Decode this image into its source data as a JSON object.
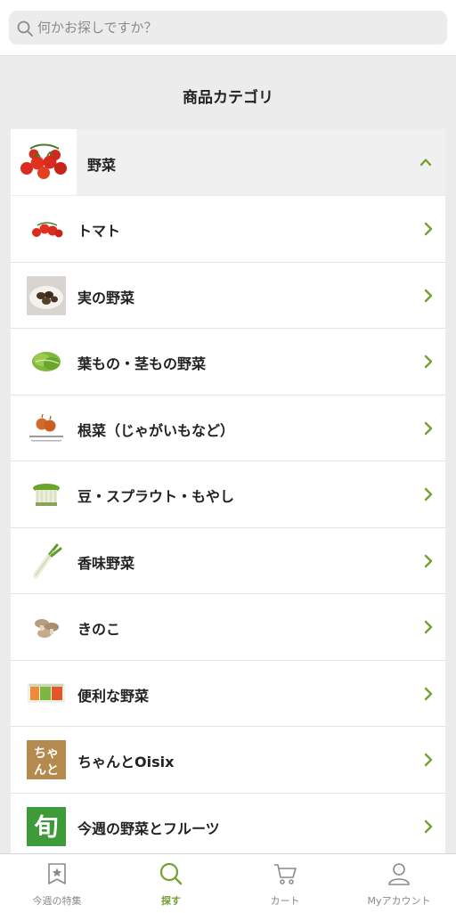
{
  "search": {
    "placeholder": "何かお探しですか？"
  },
  "page": {
    "title": "商品カテゴリ"
  },
  "category": {
    "label": "野菜",
    "expanded": true
  },
  "items": [
    {
      "label": "トマト",
      "icon": "tomato-icon"
    },
    {
      "label": "実の野菜",
      "icon": "fruit-vegetable-icon"
    },
    {
      "label": "葉もの・茎もの野菜",
      "icon": "leafy-vegetable-icon"
    },
    {
      "label": "根菜（じゃがいもなど）",
      "icon": "root-vegetable-icon"
    },
    {
      "label": "豆・スプラウト・もやし",
      "icon": "sprout-icon"
    },
    {
      "label": "香味野菜",
      "icon": "aromatic-vegetable-icon"
    },
    {
      "label": "きのこ",
      "icon": "mushroom-icon"
    },
    {
      "label": "便利な野菜",
      "icon": "packaged-vegetable-icon"
    },
    {
      "label": "ちゃんとOisix",
      "icon": "chanto-oisix-logo",
      "logo_text": "ちゃんと"
    },
    {
      "label": "今週の野菜とフルーツ",
      "icon": "shun-badge-icon",
      "logo_text": "旬"
    }
  ],
  "tabs": [
    {
      "label": "今週の特集",
      "icon": "star-bookmark-icon",
      "active": false
    },
    {
      "label": "探す",
      "icon": "search-icon",
      "active": true
    },
    {
      "label": "カート",
      "icon": "cart-icon",
      "active": false
    },
    {
      "label": "Myアカウント",
      "icon": "person-icon",
      "active": false
    }
  ],
  "colors": {
    "accent": "#76a032",
    "background": "#ececec",
    "row_background": "#ffffff"
  }
}
